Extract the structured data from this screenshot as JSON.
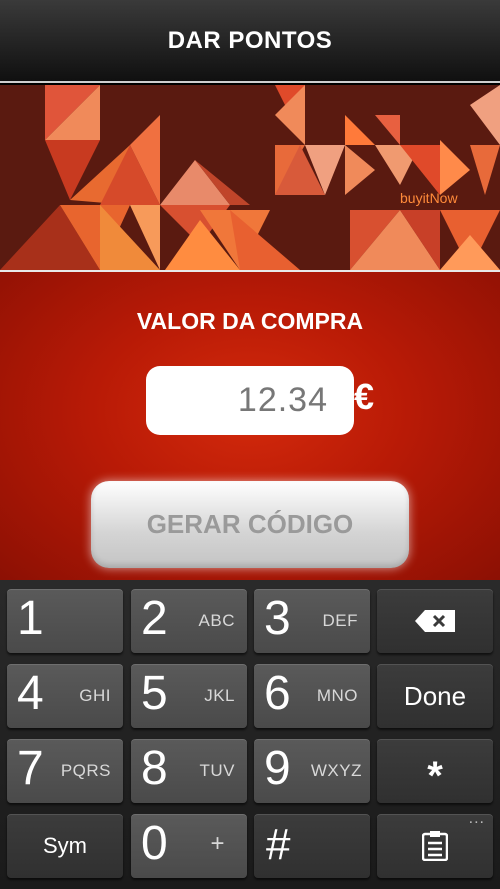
{
  "header": {
    "title": "DAR PONTOS"
  },
  "banner": {
    "brand": "buyitNow",
    "accent": "#ff6a2a"
  },
  "form": {
    "label": "VALOR DA COMPRA",
    "amount": "12.34",
    "currency": "€",
    "button_label": "GERAR CÓDIGO"
  },
  "keyboard": {
    "keys": [
      {
        "digit": "1",
        "letters": ""
      },
      {
        "digit": "2",
        "letters": "ABC"
      },
      {
        "digit": "3",
        "letters": "DEF"
      },
      {
        "digit": "4",
        "letters": "GHI"
      },
      {
        "digit": "5",
        "letters": "JKL"
      },
      {
        "digit": "6",
        "letters": "MNO"
      },
      {
        "digit": "7",
        "letters": "PQRS"
      },
      {
        "digit": "8",
        "letters": "TUV"
      },
      {
        "digit": "9",
        "letters": "WXYZ"
      },
      {
        "digit": "0",
        "letters": "+"
      }
    ],
    "sym": "Sym",
    "hash": "#",
    "done": "Done",
    "star": "*",
    "more": "..."
  }
}
